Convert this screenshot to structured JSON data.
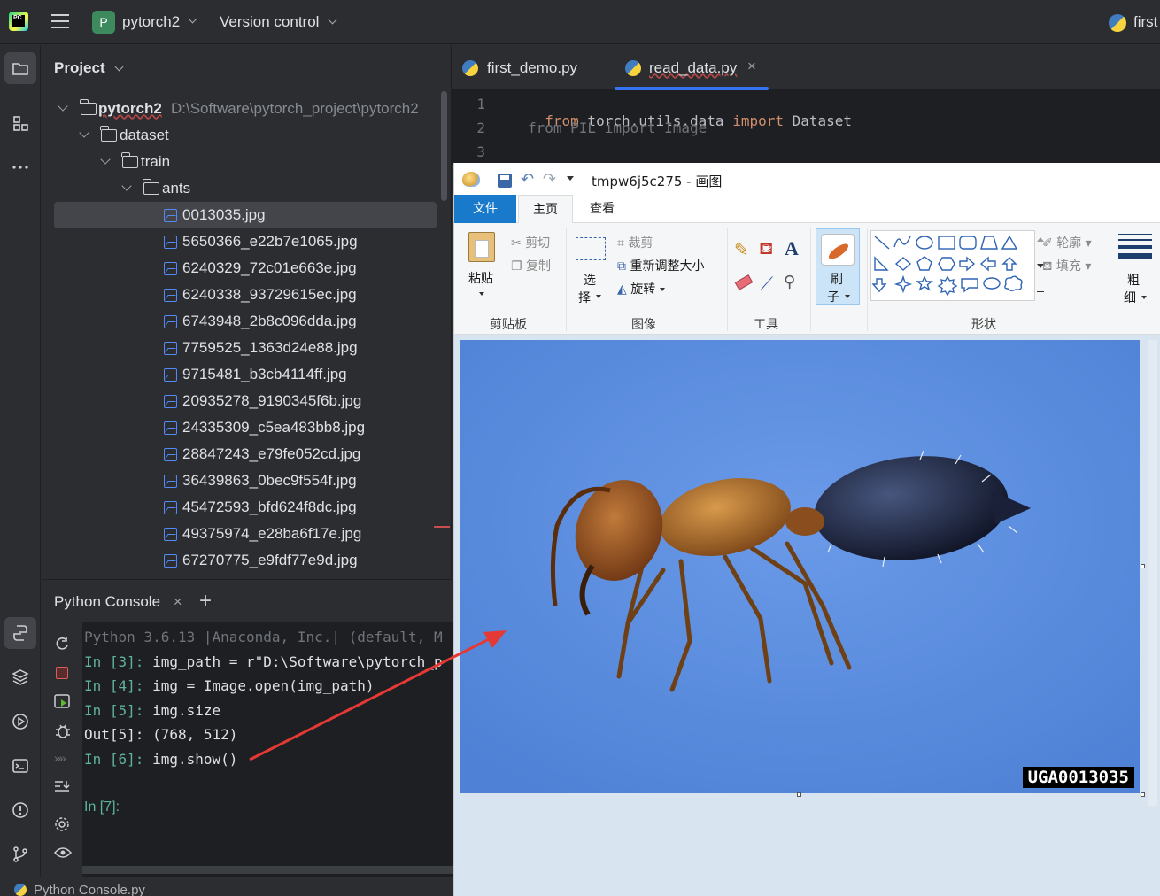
{
  "titlebar": {
    "project_name": "pytorch2",
    "vcs_label": "Version control",
    "right_project": "first"
  },
  "project_panel": {
    "title": "Project",
    "root_name": "pytorch2",
    "root_path": "D:\\Software\\pytorch_project\\pytorch2",
    "folders": [
      "dataset",
      "train",
      "ants"
    ],
    "files": [
      "0013035.jpg",
      "5650366_e22b7e1065.jpg",
      "6240329_72c01e663e.jpg",
      "6240338_93729615ec.jpg",
      "6743948_2b8c096dda.jpg",
      "7759525_1363d24e88.jpg",
      "9715481_b3cb4114ff.jpg",
      "20935278_9190345f6b.jpg",
      "24335309_c5ea483bb8.jpg",
      "28847243_e79fe052cd.jpg",
      "36439863_0bec9f554f.jpg",
      "45472593_bfd624f8dc.jpg",
      "49375974_e28ba6f17e.jpg",
      "67270775_e9fdf77e9d.jpg"
    ]
  },
  "editor": {
    "tabs": [
      {
        "label": "first_demo.py",
        "active": false
      },
      {
        "label": "read_data.py",
        "active": true
      }
    ],
    "line_numbers": [
      "1",
      "2",
      "3"
    ],
    "line1": {
      "kw1": "from",
      "mod": " torch.utils.data ",
      "kw2": "import",
      "name": " Dataset"
    },
    "line2": "from PIL import Image"
  },
  "console": {
    "tab_label": "Python Console",
    "lines": [
      {
        "prompt": "",
        "text": "Python 3.6.13 |Anaconda, Inc.| (default, M"
      },
      {
        "prompt": "In [3]: ",
        "text": "img_path = r\"D:\\Software\\pytorch_p"
      },
      {
        "prompt": "In [4]: ",
        "text": "img = Image.open(img_path)"
      },
      {
        "prompt": "In [5]: ",
        "text": "img.size"
      },
      {
        "prompt": "",
        "text": "Out[5]: (768, 512)"
      },
      {
        "prompt": "In [6]: ",
        "text": "img.show()"
      },
      {
        "prompt": "In [7]:",
        "text": ""
      }
    ],
    "status_file": "Python Console.py"
  },
  "paint": {
    "window_title": "tmpw6j5c275 - 画图",
    "tabs": [
      "文件",
      "主页",
      "查看"
    ],
    "clipboard": {
      "paste": "粘贴",
      "cut": "剪切",
      "copy": "复制",
      "group": "剪贴板"
    },
    "image": {
      "select_1": "选",
      "select_2": "择",
      "crop": "裁剪",
      "resize": "重新调整大小",
      "rotate": "旋转",
      "group": "图像"
    },
    "tools": {
      "group": "工具"
    },
    "brush": {
      "line1": "刷",
      "line2": "子"
    },
    "shapes": {
      "outline": "轮廓",
      "fill": "填充",
      "group": "形状"
    },
    "size": {
      "line1": "粗",
      "line2": "细"
    },
    "photo_caption": "UGA0013035"
  },
  "colors": {
    "accent": "#3574f0",
    "paint_blue_tab": "#1979ca",
    "photo_background": "#5f8fdd",
    "annotation_arrow": "#e53935"
  }
}
